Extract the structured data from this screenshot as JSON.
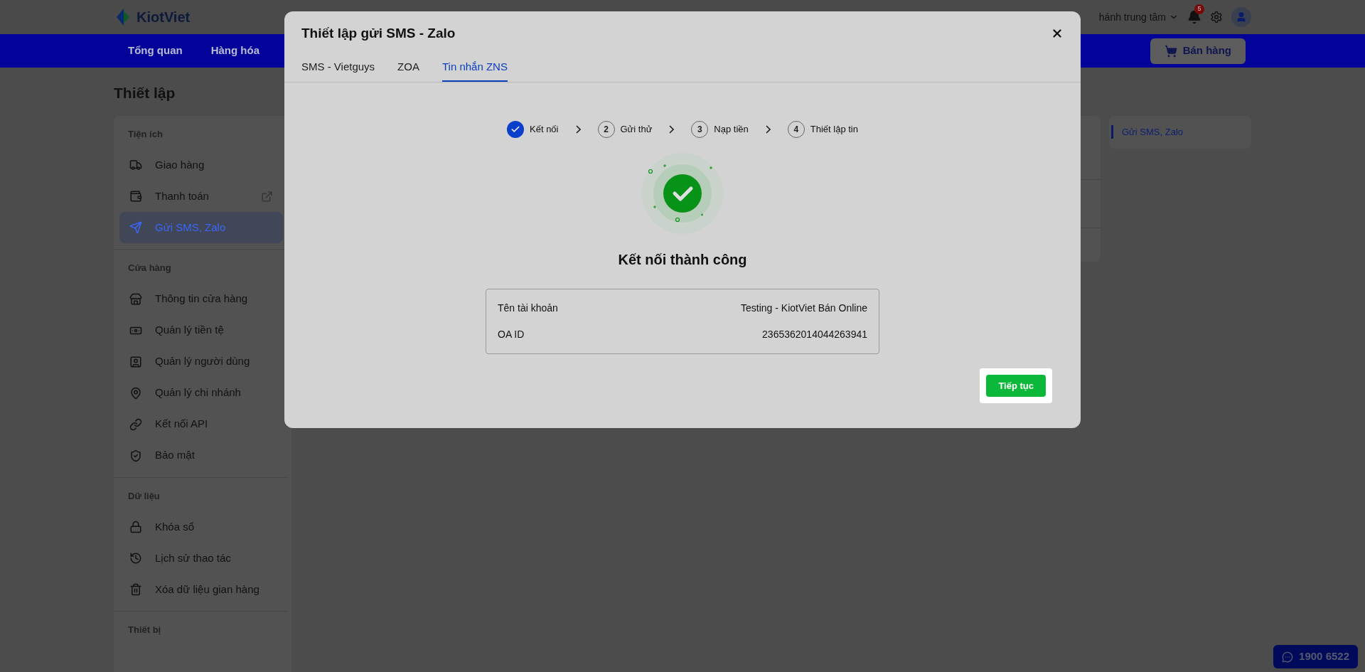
{
  "header": {
    "logo": "KiotViet",
    "branch": "hánh trung tâm",
    "notification_count": "5",
    "sell_button": "Bán hàng"
  },
  "nav": [
    {
      "label": "Tổng quan"
    },
    {
      "label": "Hàng hóa"
    }
  ],
  "page_title": "Thiết lập",
  "sidebar": [
    {
      "heading": "Tiện ích",
      "items": [
        {
          "label": "Giao hàng",
          "selected": false,
          "external": false
        },
        {
          "label": "Thanh toán",
          "selected": false,
          "external": true
        },
        {
          "label": "Gửi SMS, Zalo",
          "selected": true,
          "external": false
        }
      ]
    },
    {
      "heading": "Cửa hàng",
      "items": [
        {
          "label": "Thông tin cửa hàng",
          "selected": false,
          "external": false
        },
        {
          "label": "Quản lý tiền tệ",
          "selected": false,
          "external": false
        },
        {
          "label": "Quản lý người dùng",
          "selected": false,
          "external": false
        },
        {
          "label": "Quản lý chi nhánh",
          "selected": false,
          "external": false
        },
        {
          "label": "Kết nối API",
          "selected": false,
          "external": false
        },
        {
          "label": "Bảo mật",
          "selected": false,
          "external": false
        }
      ]
    },
    {
      "heading": "Dữ liệu",
      "items": [
        {
          "label": "Khóa sổ",
          "selected": false,
          "external": false
        },
        {
          "label": "Lịch sử thao tác",
          "selected": false,
          "external": false
        },
        {
          "label": "Xóa dữ liệu gian hàng",
          "selected": false,
          "external": false
        }
      ]
    },
    {
      "heading": "Thiết bị"
    }
  ],
  "anchor_link": "Gửi SMS, Zalo",
  "hotline": "1900 6522",
  "modal": {
    "title": "Thiết lập gửi SMS - Zalo",
    "tabs": [
      {
        "label": "SMS - Vietguys",
        "selected": false
      },
      {
        "label": "ZOA",
        "selected": false
      },
      {
        "label": "Tin nhắn ZNS",
        "selected": true
      }
    ],
    "steps": [
      {
        "label": "Kết nối",
        "done": true
      },
      {
        "number": "2",
        "label": "Gửi thử",
        "done": false
      },
      {
        "number": "3",
        "label": "Nạp tiền",
        "done": false
      },
      {
        "number": "4",
        "label": "Thiết lập tin",
        "done": false
      }
    ],
    "success_title": "Kết nối thành công",
    "info": [
      {
        "label": "Tên tài khoản",
        "value": "Testing - KiotViet Bán Online"
      },
      {
        "label": "OA ID",
        "value": "2365362014044263941"
      }
    ],
    "continue_button": "Tiếp tục"
  }
}
